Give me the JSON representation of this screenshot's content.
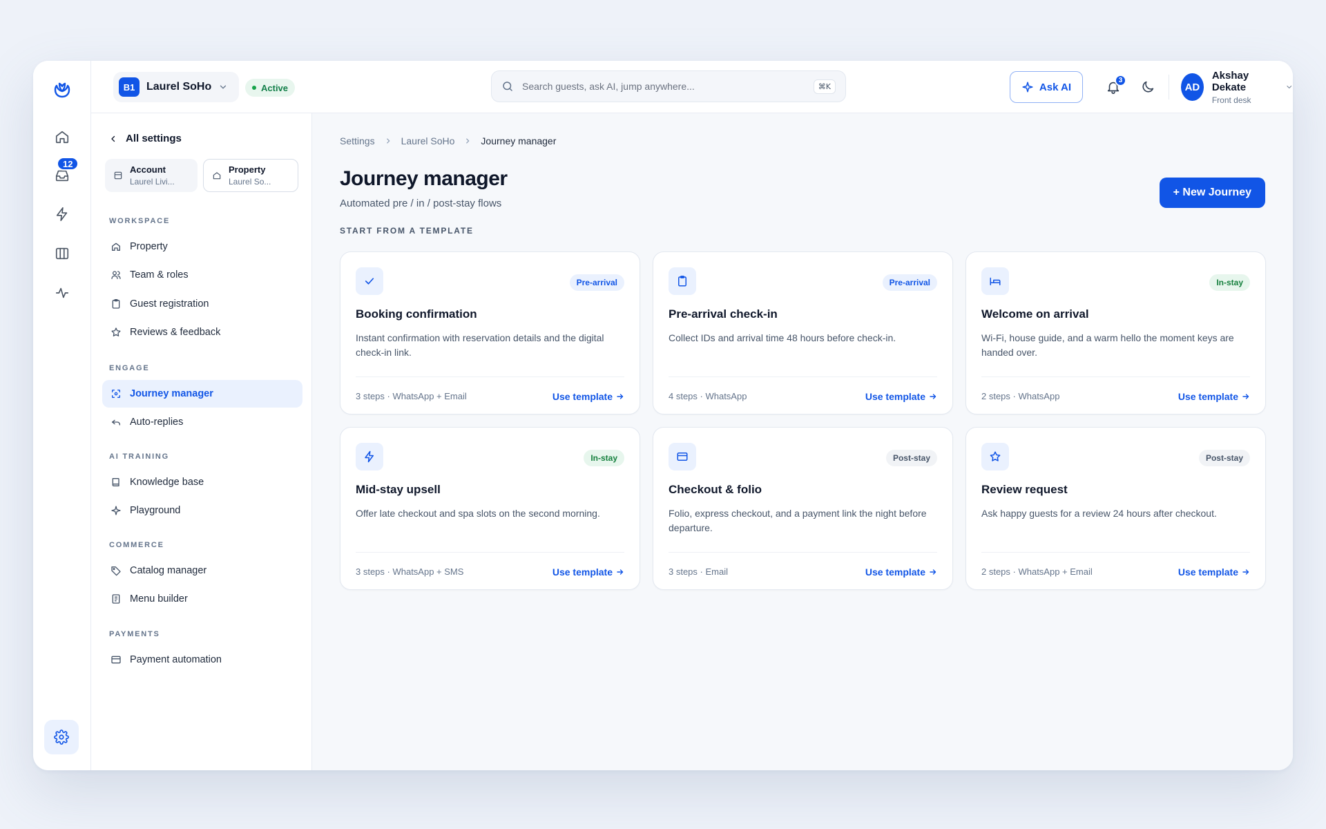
{
  "topbar": {
    "property_chip": "B1",
    "property_name": "Laurel SoHo",
    "status": "Active",
    "search_placeholder": "Search guests, ask AI, jump anywhere...",
    "search_shortcut": "⌘K",
    "ask_ai_label": "Ask AI",
    "notification_count": "3",
    "user_initials": "AD",
    "user_name": "Akshay Dekate",
    "user_role": "Front desk"
  },
  "rail": {
    "inbox_badge": "12"
  },
  "settings_nav": {
    "back_label": "All settings",
    "account": {
      "title": "Account",
      "subtitle": "Laurel Livi..."
    },
    "property": {
      "title": "Property",
      "subtitle": "Laurel So..."
    },
    "sections": {
      "workspace": "WORKSPACE",
      "engage": "ENGAGE",
      "ai_training": "AI TRAINING",
      "commerce": "COMMERCE",
      "payments": "PAYMENTS"
    },
    "items": {
      "property": "Property",
      "team": "Team & roles",
      "guest_registration": "Guest registration",
      "reviews": "Reviews & feedback",
      "journey_manager": "Journey manager",
      "auto_replies": "Auto-replies",
      "knowledge_base": "Knowledge base",
      "playground": "Playground",
      "catalog_manager": "Catalog manager",
      "menu_builder": "Menu builder",
      "payment_automation": "Payment automation"
    }
  },
  "main": {
    "breadcrumb": [
      "Settings",
      "Laurel SoHo",
      "Journey manager"
    ],
    "title": "Journey manager",
    "subtitle": "Automated pre / in / post-stay flows",
    "new_button": "+ New Journey",
    "section_label": "START FROM A TEMPLATE",
    "use_template_label": "Use template",
    "templates": [
      {
        "icon": "check-icon",
        "tag": "Pre-arrival",
        "title": "Booking confirmation",
        "description": "Instant confirmation with reservation details and the digital check-in link.",
        "meta": "3 steps · WhatsApp + Email"
      },
      {
        "icon": "clipboard-icon",
        "tag": "Pre-arrival",
        "title": "Pre-arrival check-in",
        "description": "Collect IDs and arrival time 48 hours before check-in.",
        "meta": "4 steps · WhatsApp"
      },
      {
        "icon": "bed-icon",
        "tag": "In-stay",
        "title": "Welcome on arrival",
        "description": "Wi-Fi, house guide, and a warm hello the moment keys are handed over.",
        "meta": "2 steps · WhatsApp"
      },
      {
        "icon": "lightning-icon",
        "tag": "In-stay",
        "title": "Mid-stay upsell",
        "description": "Offer late checkout and spa slots on the second morning.",
        "meta": "3 steps · WhatsApp + SMS"
      },
      {
        "icon": "credit-card-icon",
        "tag": "Post-stay",
        "title": "Checkout & folio",
        "description": "Folio, express checkout, and a payment link the night before departure.",
        "meta": "3 steps · Email"
      },
      {
        "icon": "star-icon",
        "tag": "Post-stay",
        "title": "Review request",
        "description": "Ask happy guests for a review 24 hours after checkout.",
        "meta": "2 steps · WhatsApp + Email"
      }
    ]
  }
}
